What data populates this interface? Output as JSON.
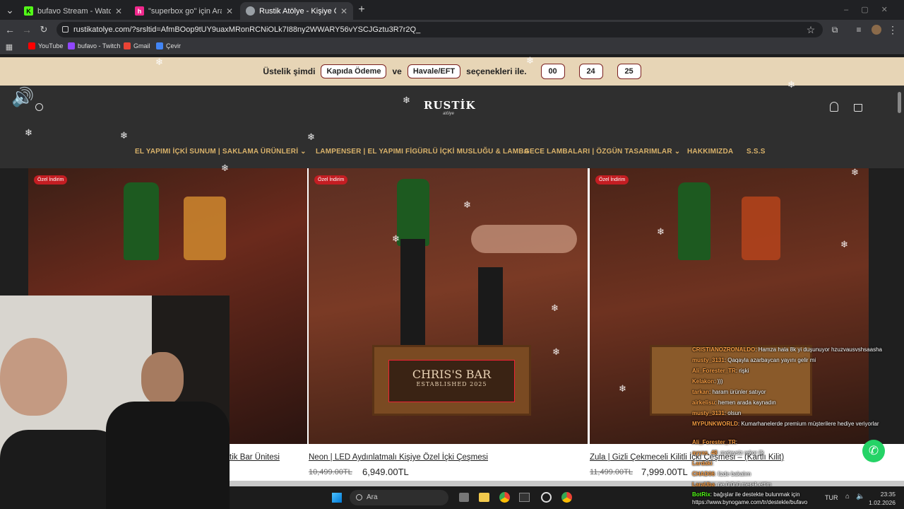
{
  "browser": {
    "tabs": [
      {
        "label": "bufavo Stream - Watch Live on",
        "favicon": "kick-icon",
        "color": "#53fc18",
        "active": false
      },
      {
        "label": "\"superbox go\" için Arama Sonu",
        "favicon": "shop-icon",
        "color": "#f0288c",
        "active": false
      },
      {
        "label": "Rustik Atölye - Kişiye Özel İ",
        "favicon": "globe-icon",
        "color": "#9aa0a6",
        "active": true
      }
    ],
    "url": "rustikatolye.com/?srsltid=AfmBOop9tUY9uaxMRonRCNiOLk7I88ny2WWARY56vYSCJGztu3R7r2Q_",
    "bookmarks": [
      {
        "label": "YouTube",
        "color": "#ff0000"
      },
      {
        "label": "bufavo - Twitch",
        "color": "#9146ff"
      },
      {
        "label": "Gmail",
        "color": "#ea4335"
      },
      {
        "label": "Çevir",
        "color": "#4285f4"
      }
    ]
  },
  "promo": {
    "text_before": "Üstelik şimdi",
    "btn1": "Kapıda Ödeme",
    "conj": "ve",
    "btn2": "Havale/EFT",
    "text_after": "seçenekleri ile.",
    "countdown": [
      "00",
      "24",
      "25"
    ]
  },
  "logo": {
    "main": "RUSTİK",
    "sub": "atölye"
  },
  "nav": [
    "EL YAPIMI İÇKİ SUNUM | SAKLAMA ÜRÜNLERİ",
    "LAMPENSER | EL YAPIMI FİGÜRLÜ İÇKİ MUSLUĞU & LAMBA",
    "GECE LAMBALARI | ÖZGÜN TASARIMLAR",
    "HAKKIMIZDA",
    "S.S.S"
  ],
  "products": [
    {
      "badge": "Özel İndirim",
      "name": "tik Bar Ünitesi",
      "old_price": "",
      "price": ""
    },
    {
      "badge": "Özel İndirim",
      "name": "Neon | LED Aydınlatmalı Kişiye Özel İçki Çeşmesi",
      "old_price": "10,499.00TL",
      "price": "6,949.00TL",
      "sign": "CHRIS'S BAR",
      "sign_sub": "ESTABLISHED 2025"
    },
    {
      "badge": "Özel İndirim",
      "name": "Zula | Gizli Çekmeceli Kilitli İçki Çeşmesi – (Kartlı Kilit)",
      "old_price": "11,499.00TL",
      "price": "7,999.00TL"
    }
  ],
  "chat": [
    {
      "user": "CRISTIANOZRONALDO",
      "msg": ": Hamza hala 8k yi duşunuyor hzuzvausvshsaasha"
    },
    {
      "user": "musty_3131",
      "msg": ": Qaqayla azarbaycan yayını gelir mi"
    },
    {
      "user": "Ali_Forester_TR",
      "msg": ": rişki"
    },
    {
      "user": "Kelakon",
      "msg": ": )))"
    },
    {
      "user": "tarkan",
      "msg": ": haram ürünler satıyor"
    },
    {
      "user": "airkelisu",
      "msg": ": hemen arada kaynadın"
    },
    {
      "user": "musty_3131",
      "msg": ": olsun"
    },
    {
      "user": "MYPUNKWORLD",
      "msg": ": Kumarhanelerde premium müşterilere hediye veriyorlar"
    },
    {
      "user": "Ali_Forester_TR",
      "msg": ":"
    },
    {
      "user": "ayyas_48",
      "msg": ": meteysiz rekor ilk"
    },
    {
      "user": "Lardaki",
      "msg": ":"
    },
    {
      "user": "CHAD06",
      "msg": ": lizde bakalım"
    },
    {
      "user": "LaraUba",
      "msg": ": ne ürünü merak ettim"
    },
    {
      "user": "BotRix",
      "msg": ": bağışlar ile destekte bulunmak için https://www.bynogame.com/tr/destekle/bufavo"
    }
  ],
  "taskbar": {
    "search": "Ara",
    "lang": "TUR",
    "time": "23:35",
    "date": "1.02.2026"
  },
  "colors": {
    "promo_bg": "#e7d5b6",
    "header_bg": "#2f2f2f",
    "nav_gold": "#d9b26a",
    "badge_red": "#c41d22",
    "whatsapp": "#25d366"
  }
}
